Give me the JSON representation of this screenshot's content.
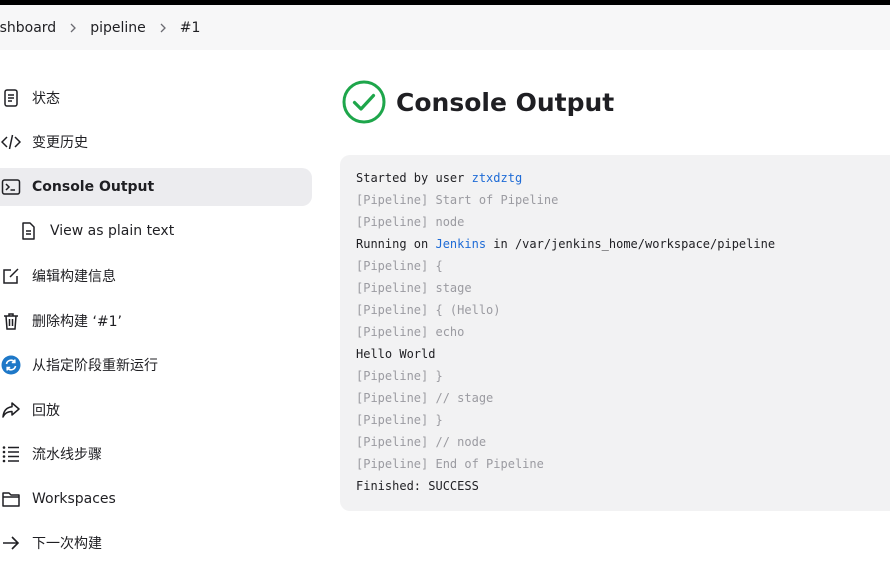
{
  "breadcrumb": [
    {
      "label": "ashboard"
    },
    {
      "label": "pipeline"
    },
    {
      "label": "#1"
    }
  ],
  "sidebar": {
    "items": [
      {
        "label": "状态",
        "icon": "document-icon"
      },
      {
        "label": "变更历史",
        "icon": "code-icon"
      },
      {
        "label": "Console Output",
        "icon": "terminal-icon",
        "active": true
      },
      {
        "label": "View as plain text",
        "icon": "file-text-icon"
      },
      {
        "label": "编辑构建信息",
        "icon": "edit-icon"
      },
      {
        "label": "删除构建 ‘#1’",
        "icon": "trash-icon"
      },
      {
        "label": "从指定阶段重新运行",
        "icon": "restart-icon"
      },
      {
        "label": "回放",
        "icon": "replay-icon"
      },
      {
        "label": "流水线步骤",
        "icon": "list-icon"
      },
      {
        "label": "Workspaces",
        "icon": "folder-icon"
      },
      {
        "label": "下一次构建",
        "icon": "arrow-right-icon"
      }
    ]
  },
  "page": {
    "title": "Console Output",
    "status_icon": "success-check-icon",
    "status_color": "#1ea64b"
  },
  "console": {
    "started_prefix": "Started by user ",
    "started_user": "ztxdztg",
    "running_prefix": "Running on ",
    "running_node": "Jenkins",
    "running_suffix": " in /var/jenkins_home/workspace/pipeline",
    "lines": [
      {
        "text": "[Pipeline] Start of Pipeline",
        "dim": true
      },
      {
        "text": "[Pipeline] node",
        "dim": true
      },
      {
        "text": "[Pipeline] {",
        "dim": true
      },
      {
        "text": "[Pipeline] stage",
        "dim": true
      },
      {
        "text": "[Pipeline] { (Hello)",
        "dim": true
      },
      {
        "text": "[Pipeline] echo",
        "dim": true
      },
      {
        "text": "Hello World",
        "dim": false
      },
      {
        "text": "[Pipeline] }",
        "dim": true
      },
      {
        "text": "[Pipeline] // stage",
        "dim": true
      },
      {
        "text": "[Pipeline] }",
        "dim": true
      },
      {
        "text": "[Pipeline] // node",
        "dim": true
      },
      {
        "text": "[Pipeline] End of Pipeline",
        "dim": true
      },
      {
        "text": "Finished: SUCCESS",
        "dim": false
      }
    ]
  },
  "colors": {
    "link": "#1e6bd6",
    "dim_text": "#9b9ba1",
    "active_bg": "#ececef"
  }
}
